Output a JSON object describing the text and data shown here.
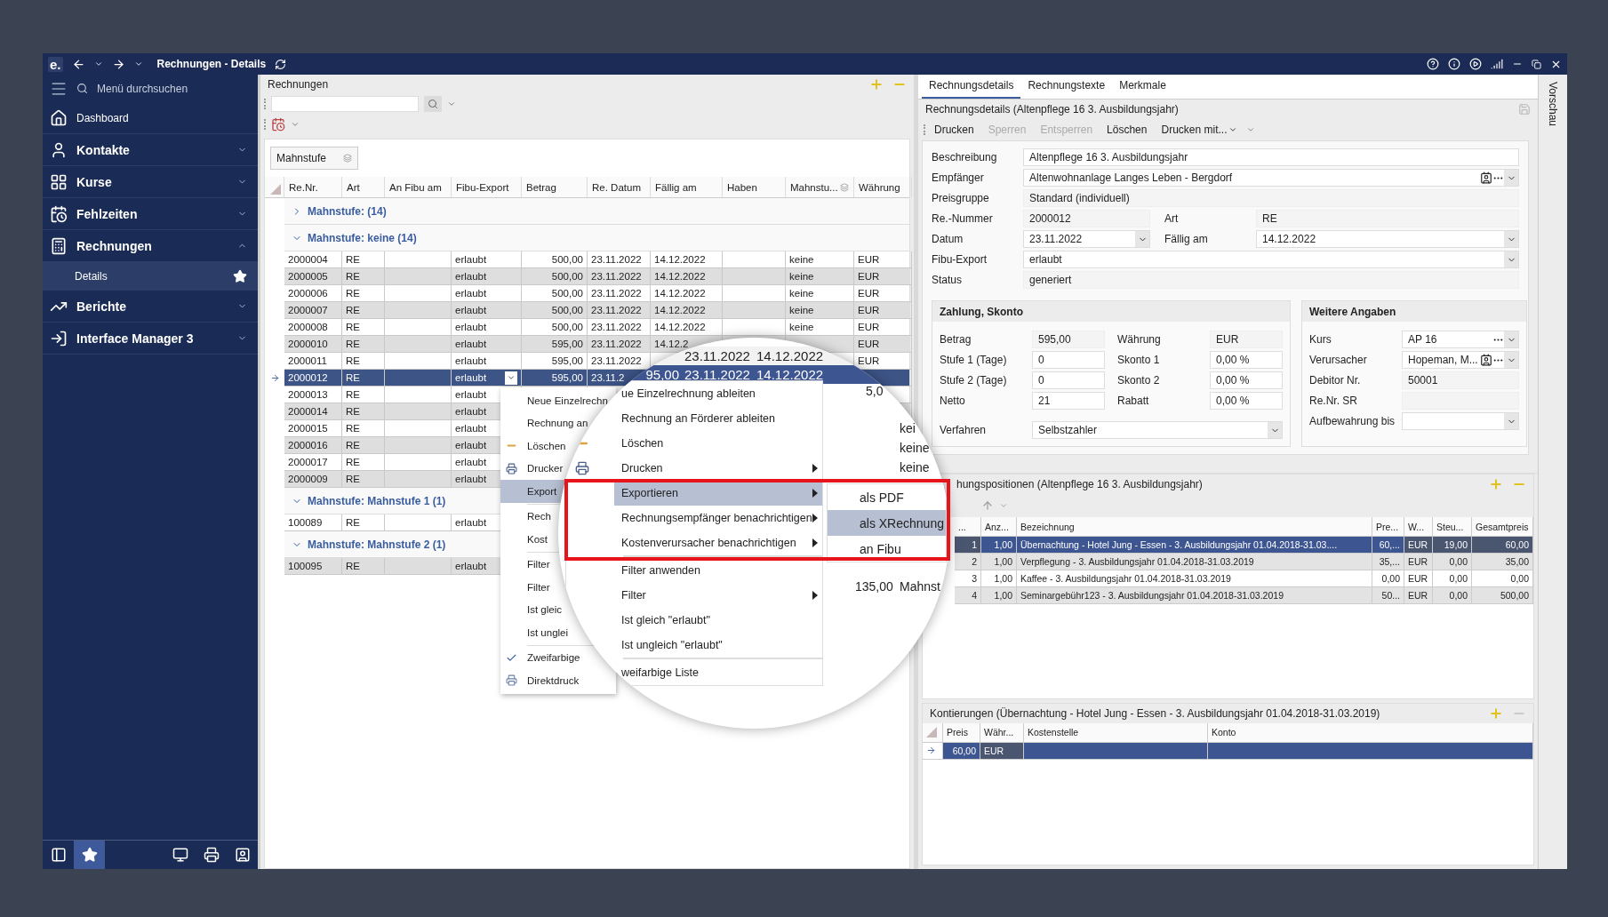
{
  "window": {
    "app_logo": "e.",
    "title": "Rechnungen - Details"
  },
  "sidebar": {
    "search_placeholder": "Menü durchsuchen",
    "nav": [
      {
        "label": "Dashboard",
        "kind": "link"
      },
      {
        "label": "Kontakte",
        "kind": "group",
        "expanded": false
      },
      {
        "label": "Kurse",
        "kind": "group",
        "expanded": false
      },
      {
        "label": "Fehlzeiten",
        "kind": "group",
        "expanded": false
      },
      {
        "label": "Rechnungen",
        "kind": "group",
        "expanded": true,
        "children": [
          {
            "label": "Details",
            "selected": true,
            "favorite": true
          }
        ]
      },
      {
        "label": "Berichte",
        "kind": "group",
        "expanded": false
      },
      {
        "label": "Interface Manager 3",
        "kind": "group",
        "expanded": false
      }
    ],
    "footer_buttons": [
      {
        "selected": false
      },
      {
        "selected": true
      },
      {
        "selected": false
      },
      {
        "selected": false
      },
      {
        "selected": false
      }
    ]
  },
  "invoices": {
    "title": "Rechnungen",
    "group_by": "Mahnstufe",
    "columns": [
      "Re.Nr.",
      "Art",
      "An Fibu am",
      "Fibu-Export",
      "Betrag",
      "Re. Datum",
      "Fällig am",
      "Haben",
      "Mahnstu...",
      "Währung"
    ],
    "groups": [
      {
        "label": "Mahnstufe: (14)",
        "expanded": false
      },
      {
        "label": "Mahnstufe: keine (14)",
        "expanded": true,
        "rows": [
          {
            "re_nr": "2000004",
            "art": "RE",
            "fibu_export": "erlaubt",
            "betrag": "500,00",
            "re_datum": "23.11.2022",
            "faellig": "14.12.2022",
            "mahnstufe": "keine",
            "waehrung": "EUR",
            "selected": false
          },
          {
            "re_nr": "2000005",
            "art": "RE",
            "fibu_export": "erlaubt",
            "betrag": "500,00",
            "re_datum": "23.11.2022",
            "faellig": "14.12.2022",
            "mahnstufe": "keine",
            "waehrung": "EUR",
            "selected": false
          },
          {
            "re_nr": "2000006",
            "art": "RE",
            "fibu_export": "erlaubt",
            "betrag": "500,00",
            "re_datum": "23.11.2022",
            "faellig": "14.12.2022",
            "mahnstufe": "keine",
            "waehrung": "EUR",
            "selected": false
          },
          {
            "re_nr": "2000007",
            "art": "RE",
            "fibu_export": "erlaubt",
            "betrag": "500,00",
            "re_datum": "23.11.2022",
            "faellig": "14.12.2022",
            "mahnstufe": "keine",
            "waehrung": "EUR",
            "selected": false
          },
          {
            "re_nr": "2000008",
            "art": "RE",
            "fibu_export": "erlaubt",
            "betrag": "500,00",
            "re_datum": "23.11.2022",
            "faellig": "14.12.2022",
            "mahnstufe": "keine",
            "waehrung": "EUR",
            "selected": false
          },
          {
            "re_nr": "2000010",
            "art": "RE",
            "fibu_export": "erlaubt",
            "betrag": "595,00",
            "re_datum": "23.11.2022",
            "faellig": "14.12.2",
            "waehrung": "EUR",
            "selected": false
          },
          {
            "re_nr": "2000011",
            "art": "RE",
            "fibu_export": "erlaubt",
            "betrag": "595,00",
            "re_datum": "23.11.2022",
            "waehrung": "EUR",
            "selected": false
          },
          {
            "re_nr": "2000012",
            "art": "RE",
            "fibu_export": "erlaubt",
            "betrag": "595,00",
            "re_datum": "23.11.2",
            "selected": true
          },
          {
            "re_nr": "2000013",
            "art": "RE",
            "fibu_export": "erlaubt",
            "selected": false
          },
          {
            "re_nr": "2000014",
            "art": "RE",
            "fibu_export": "erlaubt",
            "selected": false
          },
          {
            "re_nr": "2000015",
            "art": "RE",
            "fibu_export": "erlaubt",
            "selected": false
          },
          {
            "re_nr": "2000016",
            "art": "RE",
            "fibu_export": "erlaubt",
            "selected": false
          },
          {
            "re_nr": "2000017",
            "art": "RE",
            "fibu_export": "erlaubt",
            "selected": false
          },
          {
            "re_nr": "2000009",
            "art": "RE",
            "fibu_export": "erlaubt",
            "selected": false
          }
        ]
      },
      {
        "label": "Mahnstufe: Mahnstufe 1 (1)",
        "expanded": true,
        "rows": [
          {
            "re_nr": "100089",
            "art": "RE",
            "fibu_export": "erlaubt",
            "selected": false
          }
        ]
      },
      {
        "label": "Mahnstufe: Mahnstufe 2 (1)",
        "expanded": true,
        "rows": [
          {
            "re_nr": "100095",
            "art": "RE",
            "fibu_export": "erlaubt",
            "selected": false
          }
        ]
      }
    ]
  },
  "context_menu": {
    "items": [
      {
        "label": "Neue Einzelrechn",
        "kind": "plain",
        "selected": false
      },
      {
        "label": "Rechnung an",
        "kind": "plain",
        "selected": false
      },
      {
        "label": "Löschen",
        "kind": "delete",
        "selected": false
      },
      {
        "label": "Drucker",
        "kind": "print",
        "selected": false
      },
      {
        "label": "Export",
        "kind": "plain",
        "selected": true
      },
      {
        "kind": "separator"
      },
      {
        "label": "Rech",
        "kind": "plain",
        "selected": false
      },
      {
        "label": "Kost",
        "kind": "plain",
        "selected": false
      },
      {
        "kind": "separator"
      },
      {
        "label": "Filter",
        "kind": "plain",
        "selected": false
      },
      {
        "label": "Filter",
        "kind": "plain",
        "selected": false
      },
      {
        "label": "Ist gleic",
        "kind": "plain",
        "selected": false
      },
      {
        "label": "Ist unglei",
        "kind": "plain",
        "selected": false
      },
      {
        "kind": "separator"
      },
      {
        "label": "Zweifarbige",
        "kind": "check",
        "checked": true,
        "selected": false
      },
      {
        "label": "Direktdruck",
        "kind": "directprint",
        "selected": false
      }
    ]
  },
  "magnifier": {
    "rows": [
      {
        "re_datum": "23.11.2022",
        "faellig": "14.12.2022",
        "selected": false
      },
      {
        "betrag": "95,00",
        "re_datum": "23.11.2022",
        "faellig": "14.12.2022",
        "selected": true
      }
    ],
    "menu": [
      {
        "label": "ue Einzelrechnung ableiten",
        "kind": "plain",
        "submenu": false,
        "selected": false
      },
      {
        "label": "Rechnung an Förderer ableiten",
        "kind": "plain",
        "submenu": false,
        "selected": false
      },
      {
        "label": "Löschen",
        "kind": "delete",
        "submenu": false,
        "selected": false
      },
      {
        "label": "Drucken",
        "kind": "print",
        "submenu": true,
        "selected": false
      },
      {
        "label": "Exportieren",
        "kind": "plain",
        "submenu": true,
        "selected": true
      },
      {
        "label": "Rechnungsempfänger benachrichtigen",
        "kind": "plain",
        "submenu": true,
        "selected": false
      },
      {
        "label": "Kostenverursacher benachrichtigen",
        "kind": "plain",
        "submenu": true,
        "selected": false
      },
      {
        "kind": "separator"
      },
      {
        "label": "Filter anwenden",
        "kind": "plain",
        "submenu": false,
        "selected": false
      },
      {
        "label": "Filter",
        "kind": "plain",
        "submenu": true,
        "selected": false
      },
      {
        "label": "Ist gleich \"erlaubt\"",
        "kind": "plain",
        "submenu": false,
        "selected": false
      },
      {
        "label": "Ist ungleich \"erlaubt\"",
        "kind": "plain",
        "submenu": false,
        "selected": false
      },
      {
        "kind": "separator"
      },
      {
        "label": "weifarbige Liste",
        "kind": "plain",
        "submenu": false,
        "selected": false
      }
    ],
    "submenu": [
      {
        "label": "als PDF",
        "selected": false
      },
      {
        "label": "als XRechnung",
        "selected": true
      },
      {
        "label": "an Fibu",
        "selected": false
      }
    ],
    "haben_cell": "5,0",
    "mahnstufe_cells": [
      "kei",
      "keine",
      "keine"
    ],
    "footer_cells": [
      "135,00",
      "Mahnst"
    ]
  },
  "details": {
    "tabs": [
      {
        "label": "Rechnungsdetails",
        "selected": true
      },
      {
        "label": "Rechnungstexte",
        "selected": false
      },
      {
        "label": "Merkmale",
        "selected": false
      }
    ],
    "title": "Rechnungsdetails (Altenpflege 16 3. Ausbildungsjahr)",
    "actions": [
      {
        "label": "Drucken",
        "disabled": false,
        "kind": "button"
      },
      {
        "label": "Sperren",
        "disabled": true,
        "kind": "button"
      },
      {
        "label": "Entsperren",
        "disabled": true,
        "kind": "button"
      },
      {
        "label": "Löschen",
        "disabled": false,
        "kind": "button"
      },
      {
        "label": "Drucken mit...",
        "disabled": false,
        "kind": "dropdown"
      }
    ],
    "form": [
      [
        {
          "label": "Beschreibung",
          "value": "Altenpflege 16 3. Ausbildungsjahr",
          "kind": "text"
        }
      ],
      [
        {
          "label": "Empfänger",
          "value": "Altenwohnanlage Langes Leben - Bergdorf",
          "kind": "lookup"
        }
      ],
      [
        {
          "label": "Preisgruppe",
          "value": "Standard (individuell)",
          "kind": "readonly"
        }
      ],
      [
        {
          "label": "Re.-Nummer",
          "value": "2000012",
          "kind": "readonly"
        },
        {
          "label": "Art",
          "value": "RE",
          "kind": "readonly"
        }
      ],
      [
        {
          "label": "Datum",
          "value": "23.11.2022",
          "kind": "dropdown"
        },
        {
          "label": "Fällig am",
          "value": "14.12.2022",
          "kind": "dropdown"
        }
      ],
      [
        {
          "label": "Fibu-Export",
          "value": "erlaubt",
          "kind": "dropdown"
        }
      ],
      [
        {
          "label": "Status",
          "value": "generiert",
          "kind": "readonly"
        }
      ]
    ],
    "payment": {
      "title": "Zahlung, Skonto",
      "rows": [
        [
          {
            "label": "Betrag",
            "value": "595,00",
            "kind": "readonly"
          },
          {
            "label": "Währung",
            "value": "EUR",
            "kind": "readonly"
          }
        ],
        [
          {
            "label": "Stufe 1 (Tage)",
            "value": "0",
            "kind": "text"
          },
          {
            "label": "Skonto 1",
            "value": "0,00 %",
            "kind": "text"
          }
        ],
        [
          {
            "label": "Stufe 2 (Tage)",
            "value": "0",
            "kind": "text"
          },
          {
            "label": "Skonto 2",
            "value": "0,00 %",
            "kind": "text"
          }
        ],
        [
          {
            "label": "Netto",
            "value": "21",
            "kind": "text"
          },
          {
            "label": "Rabatt",
            "value": "0,00 %",
            "kind": "text"
          }
        ]
      ],
      "method": {
        "label": "Verfahren",
        "value": "Selbstzahler",
        "kind": "dropdown"
      }
    },
    "more": {
      "title": "Weitere Angaben",
      "rows": [
        {
          "label": "Kurs",
          "value": "AP 16",
          "kind": "picker"
        },
        {
          "label": "Verursacher",
          "value": "Hopeman, M...",
          "kind": "lookup"
        },
        {
          "label": "Debitor Nr.",
          "value": "50001",
          "kind": "readonly"
        },
        {
          "label": "Re.Nr. SR",
          "kind": "readonly"
        },
        {
          "label": "Aufbewahrung bis",
          "kind": "dropdown"
        }
      ]
    }
  },
  "positions": {
    "title": "hungspositionen (Altenpflege 16 3. Ausbildungsjahr)",
    "columns": [
      "...",
      "Anz...",
      "Bezeichnung",
      "Pre...",
      "W...",
      "Steu...",
      "Gesamtpreis"
    ],
    "rows": [
      {
        "cells": [
          "1",
          "1,00",
          "Übernachtung - Hotel Jung - Essen - 3. Ausbildungsjahr 01.04.2018-31.03....",
          "60,...",
          "EUR",
          "19,00",
          "60,00"
        ],
        "selected": true
      },
      {
        "cells": [
          "2",
          "1,00",
          "Verpflegung - 3. Ausbildungsjahr 01.04.2018-31.03.2019",
          "35,...",
          "EUR",
          "0,00",
          "35,00"
        ],
        "selected": false
      },
      {
        "cells": [
          "3",
          "1,00",
          "Kaffee - 3. Ausbildungsjahr 01.04.2018-31.03.2019",
          "0,00",
          "EUR",
          "0,00",
          "0,00"
        ],
        "selected": false
      },
      {
        "cells": [
          "4",
          "1,00",
          "Seminargebühr123 - 3. Ausbildungsjahr 01.04.2018-31.03.2019",
          "50...",
          "EUR",
          "0,00",
          "500,00"
        ],
        "selected": false
      }
    ]
  },
  "postings": {
    "title": "Kontierungen (Übernachtung - Hotel Jung - Essen - 3. Ausbildungsjahr 01.04.2018-31.03.2019)",
    "columns": [
      "Preis",
      "Währ...",
      "Kostenstelle",
      "Konto"
    ],
    "rows": [
      {
        "cells": [
          "60,00",
          "EUR"
        ],
        "selected": true
      }
    ]
  },
  "preview_tab": "Vorschau"
}
